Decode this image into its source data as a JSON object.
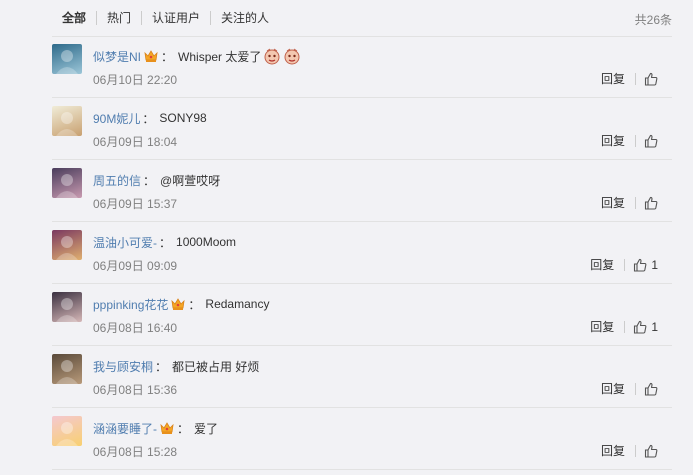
{
  "tabs": [
    "全部",
    "热门",
    "认证用户",
    "关注的人"
  ],
  "total": "共26条",
  "comments": [
    {
      "user": "似梦是NI",
      "crown": true,
      "text": "Whisper 太爱了",
      "emoji": 2,
      "time": "06月10日 22:20",
      "reply": "回复",
      "likes": "",
      "avatar": [
        "#2e6a8a",
        "#9cc6d8"
      ]
    },
    {
      "user": "90M妮儿",
      "crown": false,
      "text": "SONY98",
      "emoji": 0,
      "time": "06月09日 18:04",
      "reply": "回复",
      "likes": "",
      "avatar": [
        "#f0ecd8",
        "#c8a070"
      ]
    },
    {
      "user": "周五的信",
      "crown": false,
      "text": "@啊萱哎呀",
      "emoji": 0,
      "time": "06月09日 15:37",
      "reply": "回复",
      "likes": "",
      "avatar": [
        "#4a3d5c",
        "#c89ab0"
      ]
    },
    {
      "user": "温油小可爱-",
      "crown": false,
      "text": "1000Moom",
      "emoji": 0,
      "time": "06月09日 09:09",
      "reply": "回复",
      "likes": "1",
      "avatar": [
        "#7a3860",
        "#e0b070"
      ]
    },
    {
      "user": "pppinking花花",
      "crown": true,
      "text": "Redamancy",
      "emoji": 0,
      "time": "06月08日 16:40",
      "reply": "回复",
      "likes": "1",
      "avatar": [
        "#3a3040",
        "#d6b8b8"
      ]
    },
    {
      "user": "我与顾安桐",
      "crown": false,
      "text": "都已被占用 好烦",
      "emoji": 0,
      "time": "06月08日 15:36",
      "reply": "回复",
      "likes": "",
      "avatar": [
        "#5a4a3a",
        "#b89a7a"
      ]
    },
    {
      "user": "涵涵要睡了-",
      "crown": true,
      "text": "爱了",
      "emoji": 0,
      "time": "06月08日 15:28",
      "reply": "回复",
      "likes": "",
      "avatar": [
        "#f4c8d0",
        "#f8d070"
      ]
    }
  ]
}
